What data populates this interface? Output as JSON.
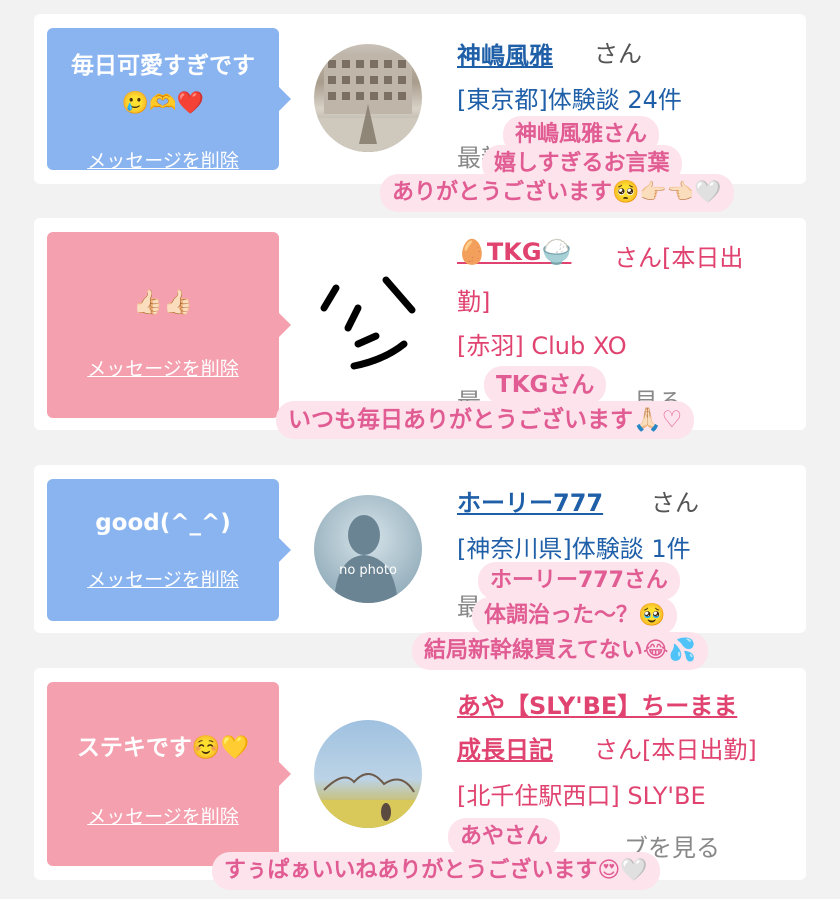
{
  "cards": [
    {
      "message": "毎日可愛すぎです",
      "message_emoji": "🥲🫶❤️",
      "delete_label": "メッセージを削除",
      "name": "神嶋風雅",
      "san": "さん",
      "info": "[東京都]体験談 24件",
      "partial": "最新",
      "stickers": [
        "神嶋風雅さん",
        "嬉しすぎるお言葉",
        "ありがとうございます🥺👉🏻👈🏻🤍"
      ]
    },
    {
      "message": "👍🏻👍🏻",
      "delete_label": "メッセージを削除",
      "name": "🥚TKG🍚",
      "san": "さん[本日出",
      "san2": "勤]",
      "info": "[赤羽] Club XO",
      "partial": "最",
      "partial2": "見る",
      "stickers": [
        "TKGさん",
        "いつも毎日ありがとうございます🙏🏻♡"
      ]
    },
    {
      "message": "good(^_^)",
      "delete_label": "メッセージを削除",
      "name": "ホーリー777",
      "san": "さん",
      "info": "[神奈川県]体験談 1件",
      "partial": "最",
      "no_photo": "no photo",
      "stickers": [
        "ホーリー777さん",
        "体調治った〜？🥹",
        "結局新幹線買えてない😂💦"
      ]
    },
    {
      "message": "ステキです☺️💛",
      "delete_label": "メッセージを削除",
      "name": "あや【SLY'BE】ちーまま",
      "name2": "成長日記",
      "san": "さん[本日出勤]",
      "info": "[北千住駅西口] SLY'BE",
      "partial": "ブを見る",
      "stickers": [
        "あやさん",
        "すぅぱぁいいねありがとうございます😍🤍"
      ]
    }
  ],
  "colors": {
    "blue_bubble": "#8ab4f0",
    "pink_bubble": "#f4a0ae",
    "blue_link": "#1f5fa8",
    "pink_link": "#e0436f",
    "sticker_bg": "#fde3ec",
    "sticker_text": "#e05c92"
  }
}
